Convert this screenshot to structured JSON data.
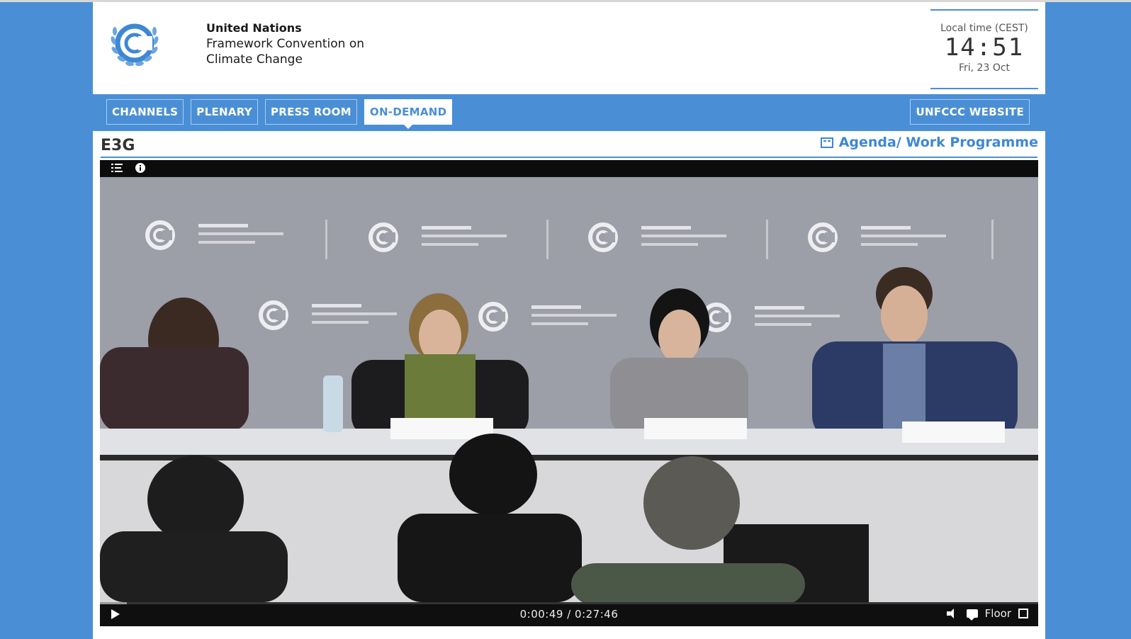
{
  "header": {
    "org_line1": "United Nations",
    "org_line2": "Framework Convention on",
    "org_line3": "Climate Change",
    "time_label": "Local time (CEST)",
    "time": "14:51",
    "date": "Fri, 23 Oct"
  },
  "nav": {
    "tabs": [
      {
        "label": "CHANNELS",
        "active": false
      },
      {
        "label": "PLENARY",
        "active": false
      },
      {
        "label": "PRESS ROOM",
        "active": false
      },
      {
        "label": "ON-DEMAND",
        "active": true
      }
    ],
    "website_label": "UNFCCC WEBSITE"
  },
  "content": {
    "title": "E3G",
    "agenda_label": "Agenda/ Work Programme"
  },
  "player": {
    "top_icons": [
      "playlist-icon",
      "info-icon"
    ],
    "time_display": "0:00:49 / 0:27:46",
    "progress": 0.029,
    "audio_label": "Floor"
  },
  "colors": {
    "brand_blue": "#4a8fd6",
    "link_blue": "#3e87d4"
  }
}
